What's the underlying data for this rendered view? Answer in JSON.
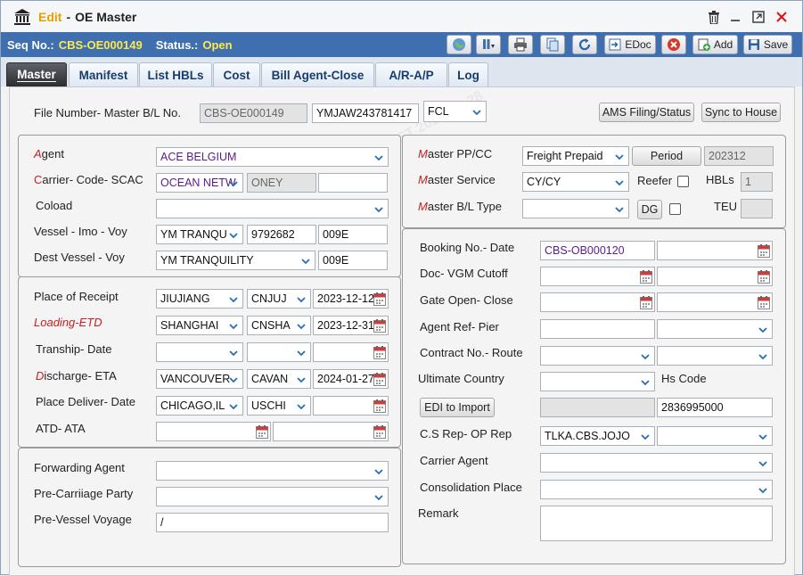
{
  "window": {
    "mode": "Edit",
    "separator": "-",
    "title": "OE Master"
  },
  "infobar": {
    "seq_label": "Seq No.:",
    "seq_value": "CBS-OE000149",
    "status_label": "Status.:",
    "status_value": "Open",
    "buttons": {
      "edoc": "EDoc",
      "add": "Add",
      "save": "Save"
    }
  },
  "tabs": [
    "Master",
    "Manifest",
    "List HBLs",
    "Cost",
    "Bill Agent-Close",
    "A/R-A/P",
    "Log"
  ],
  "header": {
    "file_label": "File Number- Master B/L No.",
    "file_number": "CBS-OE000149",
    "master_bl": "YMJAW243781417",
    "load_type": "FCL",
    "ams_button": "AMS Filing/Status",
    "sync_button": "Sync to House"
  },
  "agent_panel": {
    "agent_label_first": "A",
    "agent_label_rest": "gent",
    "agent_value": "ACE BELGIUM",
    "carrier_label_first": "C",
    "carrier_label_rest": "arrier- Code- SCAC",
    "carrier_value": "OCEAN NETW",
    "carrier_code": "ONEY",
    "carrier_scac": "",
    "coload_label": "Coload",
    "coload_value": "",
    "vessel_label": "Vessel - Imo - Voy",
    "vessel_value": "YM TRANQU",
    "imo_value": "9792682",
    "voy_value": "009E",
    "dest_vessel_label": "Dest Vessel - Voy",
    "dest_vessel_value": "YM TRANQUILITY",
    "dest_voy_value": "009E"
  },
  "routing_panel": {
    "receipt_label": "Place of Receipt",
    "receipt_place": "JIUJIANG",
    "receipt_code": "CNJUJ",
    "receipt_date": "2023-12-12",
    "loading_label_first": "L",
    "loading_label_mid": "oading-",
    "loading_label_etd": "ETD",
    "loading_place": "SHANGHAI",
    "loading_code": "CNSHA",
    "loading_date": "2023-12-31",
    "tranship_label": "Tranship- Date",
    "discharge_label_first": "D",
    "discharge_label_rest": "ischarge- ETA",
    "discharge_place": "VANCOUVER",
    "discharge_code": "CAVAN",
    "discharge_date": "2024-01-27",
    "deliver_label": "Place Deliver- Date",
    "deliver_place": "CHICAGO,IL",
    "deliver_code": "USCHI",
    "atd_label": "ATD- ATA"
  },
  "parties_panel": {
    "forwarding_label": "Forwarding Agent",
    "precarriage_label": "Pre-Carriiage Party",
    "prevessel_label": "Pre-Vessel Voyage",
    "prevessel_value": "/"
  },
  "master_panel": {
    "pp_label_first": "M",
    "pp_label_rest": "aster PP/CC",
    "pp_value": "Freight Prepaid",
    "period_button": "Period",
    "period_value": "202312",
    "service_label_first": "M",
    "service_label_rest": "aster Service",
    "service_value": "CY/CY",
    "reefer_label": "Reefer",
    "hbls_label": "HBLs",
    "hbls_value": "1",
    "bltype_label_first": "M",
    "bltype_label_rest": "aster B/L Type",
    "dg_button": "DG",
    "teu_label": "TEU"
  },
  "booking_panel": {
    "booking_label": "Booking No.- Date",
    "booking_value": "CBS-OB000120",
    "vgm_label": "Doc- VGM Cutoff",
    "gate_label": "Gate Open- Close",
    "agentref_label": "Agent Ref- Pier",
    "contract_label": "Contract No.- Route",
    "country_label": "Ultimate Country",
    "hscode_label": "Hs Code",
    "edi_button": "EDI to Import",
    "hscode_value": "2836995000",
    "csrep_label": "C.S Rep- OP Rep",
    "csrep_value": "TLKA.CBS.JOJO",
    "carrier_agent_label": "Carrier Agent",
    "consolidation_label": "Consolidation Place",
    "remark_label": "Remark"
  },
  "watermark": "TLKA.CBS.TEST 2024-08-28"
}
